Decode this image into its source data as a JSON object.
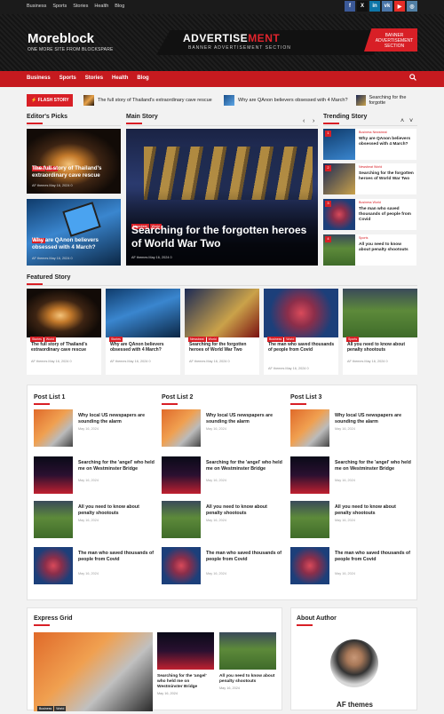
{
  "topbar": {
    "links": [
      "Business",
      "Sports",
      "Stories",
      "Health",
      "Blog"
    ],
    "social": [
      {
        "name": "facebook-icon",
        "glyph": "f",
        "color": "#3b5998"
      },
      {
        "name": "x-icon",
        "glyph": "X",
        "color": "#111"
      },
      {
        "name": "linkedin-icon",
        "glyph": "in",
        "color": "#0e76a8"
      },
      {
        "name": "vk-icon",
        "glyph": "vk",
        "color": "#4a76a8"
      },
      {
        "name": "youtube-icon",
        "glyph": "▶",
        "color": "#e52d27"
      },
      {
        "name": "instagram-icon",
        "glyph": "◎",
        "color": "#517fa4"
      }
    ]
  },
  "header": {
    "logo": "Moreblock",
    "tagline": "ONE MORE SITE FROM BLOCKSPARE",
    "ad": {
      "title_a": "ADVERTISE",
      "title_b": "MENT",
      "subtitle": "BANNER ADVERTISEMENT SECTION",
      "side": "BANNER ADVERTISEMENT SECTION"
    }
  },
  "nav": {
    "items": [
      "Business",
      "Sports",
      "Stories",
      "Health",
      "Blog"
    ]
  },
  "ticker": {
    "label": "FLASH STORY",
    "items": [
      "The full story of Thailand's extraordinary cave rescue",
      "Why are QAnon believers obsessed with 4 March?",
      "Searching for the forgotte"
    ]
  },
  "sections": {
    "editors": "Editor's Picks",
    "main": "Main Story",
    "trending": "Trending Story",
    "featured": "Featured Story"
  },
  "editors": [
    {
      "badges": [
        "Stories",
        "World"
      ],
      "title": "The full story of Thailand's extraordinary cave rescue",
      "author": "AF themes",
      "date": "May 16, 2024",
      "comments": "0"
    },
    {
      "badges": [
        "Stories"
      ],
      "title": "Why are QAnon believers obsessed with 4 March?",
      "author": "AF themes",
      "date": "May 16, 2024",
      "comments": "0"
    }
  ],
  "main_story": {
    "badges": [
      "Newsbeat",
      "World"
    ],
    "title": "Searching for the forgotten heroes of World War Two",
    "author": "AF themes",
    "date": "May 16, 2024",
    "comments": "0"
  },
  "trending": [
    {
      "cat": "Business  Newsbeat",
      "title": "Why are QAnon believers obsessed with 4 March?"
    },
    {
      "cat": "Newsbeat  World",
      "title": "Searching for the forgotten heroes of World War Two"
    },
    {
      "cat": "Business  World",
      "title": "The man who saved thousands of people from Covid"
    },
    {
      "cat": "Sports",
      "title": "All you need to know about penalty shootouts"
    }
  ],
  "featured": [
    {
      "badges": [
        "Stories",
        "World"
      ],
      "title": "The full story of Thailand's extraordinary cave rescue",
      "meta": "AF themes   May 16, 2024   0"
    },
    {
      "badges": [
        "Stories"
      ],
      "title": "Why are QAnon believers obsessed with 4 March?",
      "meta": "AF themes   May 16, 2024   0"
    },
    {
      "badges": [
        "Newsbeat",
        "World"
      ],
      "title": "Searching for the forgotten heroes of World War Two",
      "meta": "AF themes   May 16, 2024   0"
    },
    {
      "badges": [
        "Business",
        "World"
      ],
      "title": "The man who saved thousands of people from Covid",
      "meta": "AF themes   May 16, 2024   0"
    },
    {
      "badges": [
        "Sports"
      ],
      "title": "All you need to know about penalty shootouts",
      "meta": "AF themes   May 16, 2024   0"
    }
  ],
  "postlists": {
    "titles": [
      "Post List 1",
      "Post List 2",
      "Post List 3"
    ],
    "items": [
      {
        "title": "Why local US newspapers are sounding the alarm",
        "date": "May 16, 2024"
      },
      {
        "title": "Searching for the 'angel' who held me on Westminster Bridge",
        "date": "May 16, 2024"
      },
      {
        "title": "All you need to know about penalty shootouts",
        "date": "May 16, 2024"
      },
      {
        "title": "The man who saved thousands of people from Covid",
        "date": "May 16, 2024"
      }
    ]
  },
  "express": {
    "title": "Express Grid",
    "badges": [
      "Business",
      "World"
    ],
    "items": [
      {
        "title": "Searching for the 'angel' who held me on Westminster Bridge",
        "date": "May 16, 2024"
      },
      {
        "title": "All you need to know about penalty shootouts",
        "date": "May 16, 2024"
      }
    ]
  },
  "about": {
    "title": "About Author",
    "name": "AF themes"
  },
  "colors": {
    "accent": "#d81f26",
    "nav": "#c61a1f"
  }
}
